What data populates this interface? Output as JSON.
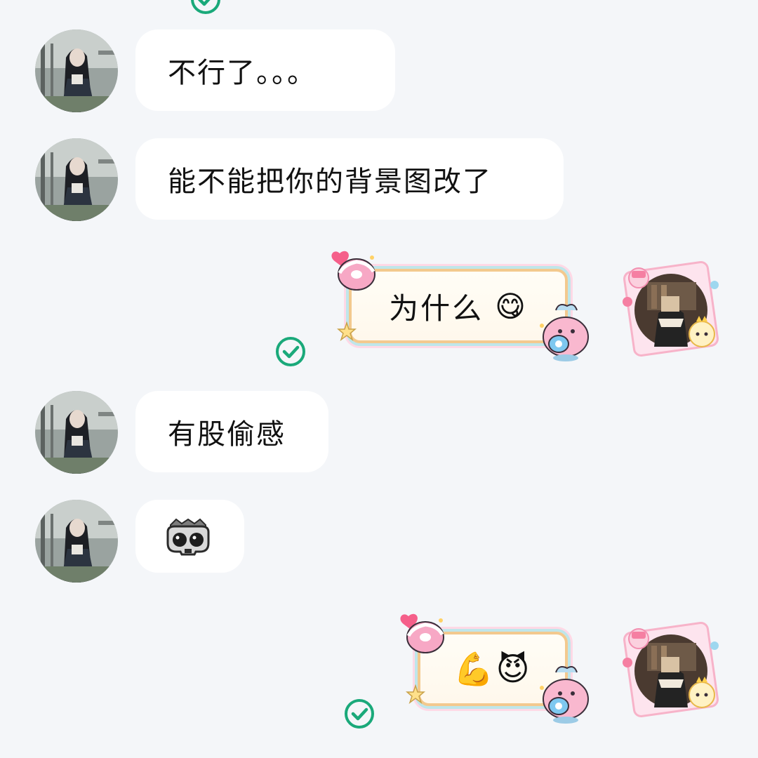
{
  "chat": {
    "messages": [
      {
        "side": "in",
        "text": "不行了。。。"
      },
      {
        "side": "in",
        "text": "能不能把你的背景图改了"
      },
      {
        "side": "out",
        "text": "为什么",
        "emoji": "😋",
        "status": "read-check-icon"
      },
      {
        "side": "in",
        "text": "有股偷感"
      },
      {
        "side": "in",
        "sticker": "skull-mask-sticker"
      },
      {
        "side": "out",
        "text": "",
        "emoji": "💪😈",
        "status": "read-check-icon"
      }
    ]
  },
  "colors": {
    "background": "#f4f6f9",
    "bubble_in": "#ffffff",
    "check_green": "#1aa97a",
    "frame_gold": "#f3c98e",
    "frame_teal": "#bfe6ea",
    "frame_pink": "#ffd9e6"
  }
}
